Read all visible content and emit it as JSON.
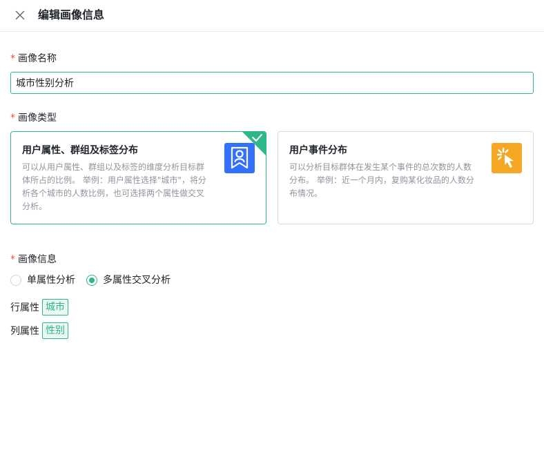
{
  "header": {
    "title": "编辑画像信息",
    "close_icon": "close-icon"
  },
  "form": {
    "required_mark": "*",
    "name": {
      "label": "画像名称",
      "value": "城市性别分析"
    },
    "type": {
      "label": "画像类型",
      "options": [
        {
          "title": "用户属性、群组及标签分布",
          "desc": "可以从用户属性、群组以及标签的维度分析目标群体所占的比例。 举例：用户属性选择\"城市\"，将分析各个城市的人数比例，也可选择两个属性做交叉分析。",
          "icon": "user-badge-icon",
          "selected": true
        },
        {
          "title": "用户事件分布",
          "desc": "可以分析目标群体在发生某个事件的总次数的人数分布。 举例：近一个月内，复购某化妆品的人数分布情况。",
          "icon": "click-cursor-icon",
          "selected": false
        }
      ]
    },
    "info": {
      "label": "画像信息",
      "modes": [
        {
          "label": "单属性分析",
          "checked": false
        },
        {
          "label": "多属性交叉分析",
          "checked": true
        }
      ],
      "row_attr": {
        "label": "行属性",
        "tag": "城市"
      },
      "col_attr": {
        "label": "列属性",
        "tag": "性别"
      }
    }
  },
  "colors": {
    "accent": "#2fb788",
    "required": "#f54a45",
    "icon_blue": "#3370ff",
    "icon_orange": "#f5a623"
  }
}
